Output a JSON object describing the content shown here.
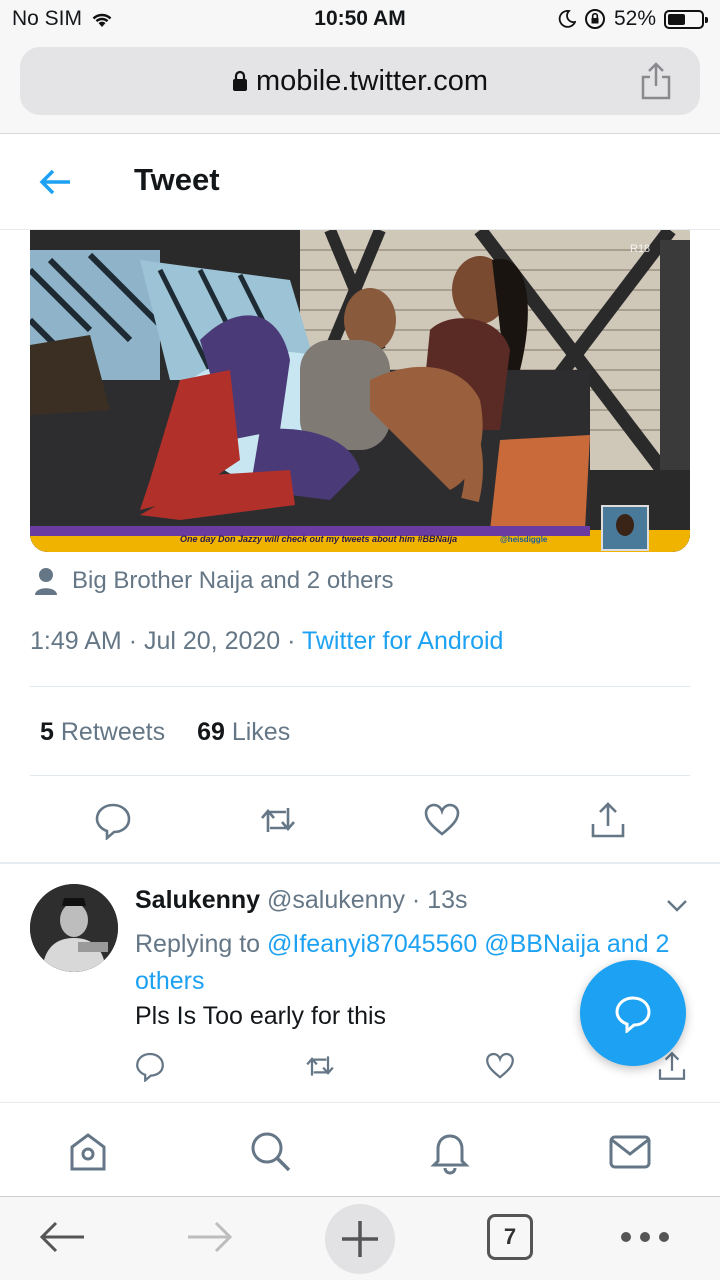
{
  "status_bar": {
    "carrier": "No SIM",
    "time": "10:50 AM",
    "battery_percent": "52%",
    "battery_level": 0.52,
    "icons": [
      "wifi-icon",
      "moon-icon",
      "orientation-lock-icon",
      "battery-icon"
    ]
  },
  "browser": {
    "url": "mobile.twitter.com",
    "icons": [
      "lock-icon",
      "share-icon"
    ]
  },
  "header": {
    "title": "Tweet",
    "back_icon": "back-arrow-icon"
  },
  "tweet": {
    "media_overlay_text": "One day Don Jazzy will check out my tweets about him #BBNaija",
    "media_overlay_handle": "@heisdiggle",
    "media_rating": "R18",
    "people": "Big Brother Naija and 2 others",
    "time": "1:49 AM",
    "date": "Jul 20, 2020",
    "separator": "·",
    "source": "Twitter for Android",
    "retweets_count": "5",
    "retweets_label": "Retweets",
    "likes_count": "69",
    "likes_label": "Likes",
    "action_icons": [
      "reply-icon",
      "retweet-icon",
      "like-icon",
      "share-icon"
    ]
  },
  "reply": {
    "name": "Salukenny",
    "handle": "@salukenny",
    "time": "13s",
    "replying_prefix": "Replying to",
    "mentions": "@Ifeanyi87045560 @BBNaija and 2 others",
    "text": "Pls Is Too early for this"
  },
  "fab": {
    "icon": "compose-reply-icon"
  },
  "tab_bar": {
    "items": [
      "home-icon",
      "search-icon",
      "notifications-icon",
      "messages-icon"
    ]
  },
  "safari_toolbar": {
    "tabs_count": "7",
    "items": [
      "back-icon",
      "forward-icon",
      "new-tab-icon",
      "tabs-icon",
      "more-icon"
    ]
  },
  "colors": {
    "accent": "#1da1f2",
    "text_primary": "#14171a",
    "text_secondary": "#657786",
    "fab": "#1da1f2"
  }
}
